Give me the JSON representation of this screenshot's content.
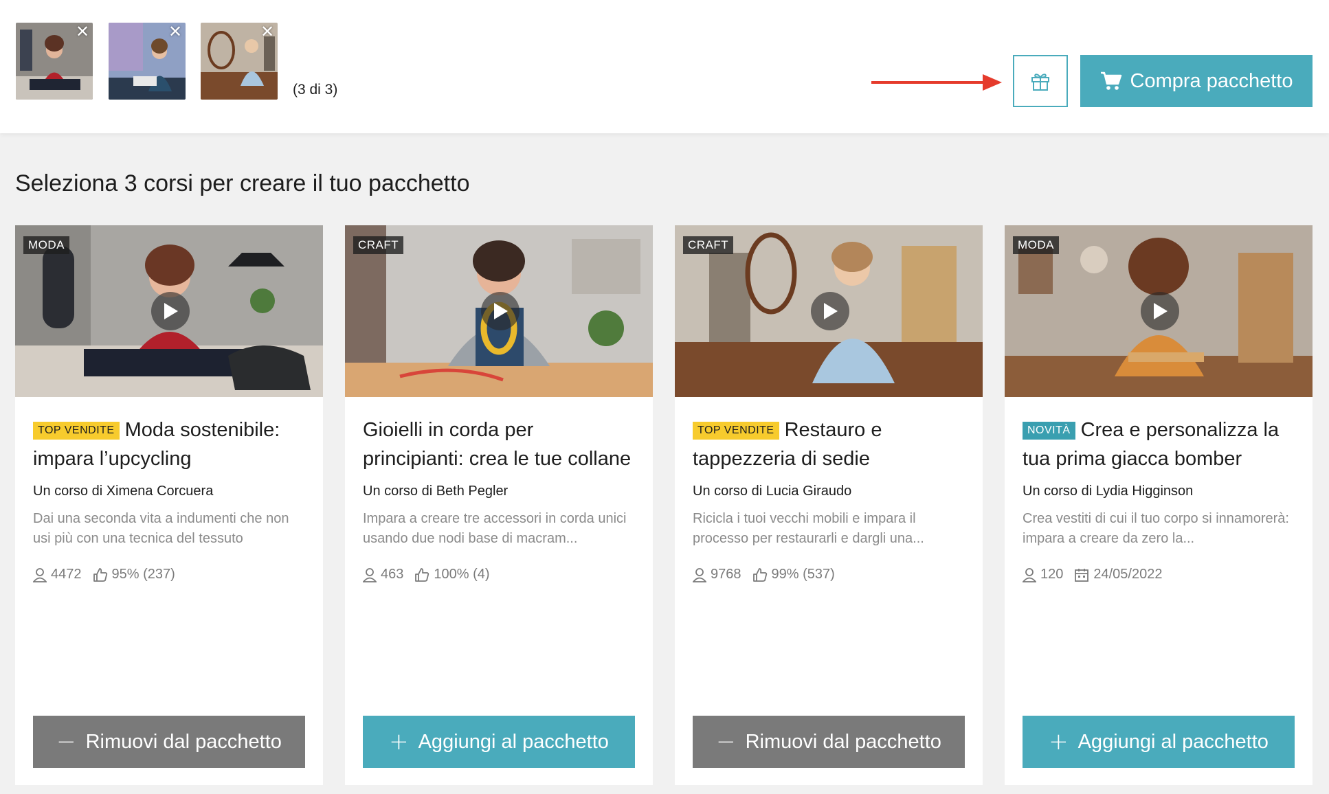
{
  "selection": {
    "count_label": "(3 di 3)",
    "thumbnails": [
      {
        "name": "selected-course-1",
        "close_label": "✕"
      },
      {
        "name": "selected-course-2",
        "close_label": "✕"
      },
      {
        "name": "selected-course-3",
        "close_label": "✕"
      }
    ]
  },
  "toolbar": {
    "gift_icon": "gift-icon",
    "buy_label": "Compra pacchetto",
    "buy_icon": "cart-icon"
  },
  "colors": {
    "accent": "#4aabbc",
    "remove": "#7a7a7a",
    "badge_top": "#f7cb2d",
    "badge_new": "#3a9fb0",
    "annotation_arrow": "#e53b2c"
  },
  "main": {
    "heading": "Seleziona 3 corsi per creare il tuo pacchetto",
    "cards": [
      {
        "category": "MODA",
        "badge": "TOP VENDITE",
        "title": "Moda sostenibile: impara l’upcycling",
        "author": "Un corso di Ximena Corcuera",
        "description": "Dai una seconda vita a indumenti che non usi più con una tecnica del tessuto",
        "students": "4472",
        "rating": "95% (237)",
        "action_symbol": "−",
        "action_label": "Rimuovi dal pacchetto"
      },
      {
        "category": "CRAFT",
        "badge": "",
        "title": "Gioielli in corda per principianti: crea le tue collane",
        "author": "Un corso di Beth Pegler",
        "description": "Impara a creare tre accessori in corda unici usando due nodi base di macram...",
        "students": "463",
        "rating": "100% (4)",
        "action_symbol": "+",
        "action_label": "Aggiungi al pacchetto"
      },
      {
        "category": "CRAFT",
        "badge": "TOP VENDITE",
        "title": "Restauro e tappezzeria di sedie",
        "author": "Un corso di Lucia Giraudo",
        "description": "Ricicla i tuoi vecchi mobili e impara il processo per restaurarli e dargli una...",
        "students": "9768",
        "rating": "99% (537)",
        "action_symbol": "−",
        "action_label": "Rimuovi dal pacchetto"
      },
      {
        "category": "MODA",
        "badge": "NOVITÀ",
        "title": "Crea e personalizza la tua prima giacca bomber",
        "author": "Un corso di Lydia Higginson",
        "description": "Crea vestiti di cui il tuo corpo si innamorerà: impara a creare da zero la...",
        "students": "120",
        "date": "24/05/2022",
        "action_symbol": "+",
        "action_label": "Aggiungi al pacchetto"
      }
    ]
  }
}
